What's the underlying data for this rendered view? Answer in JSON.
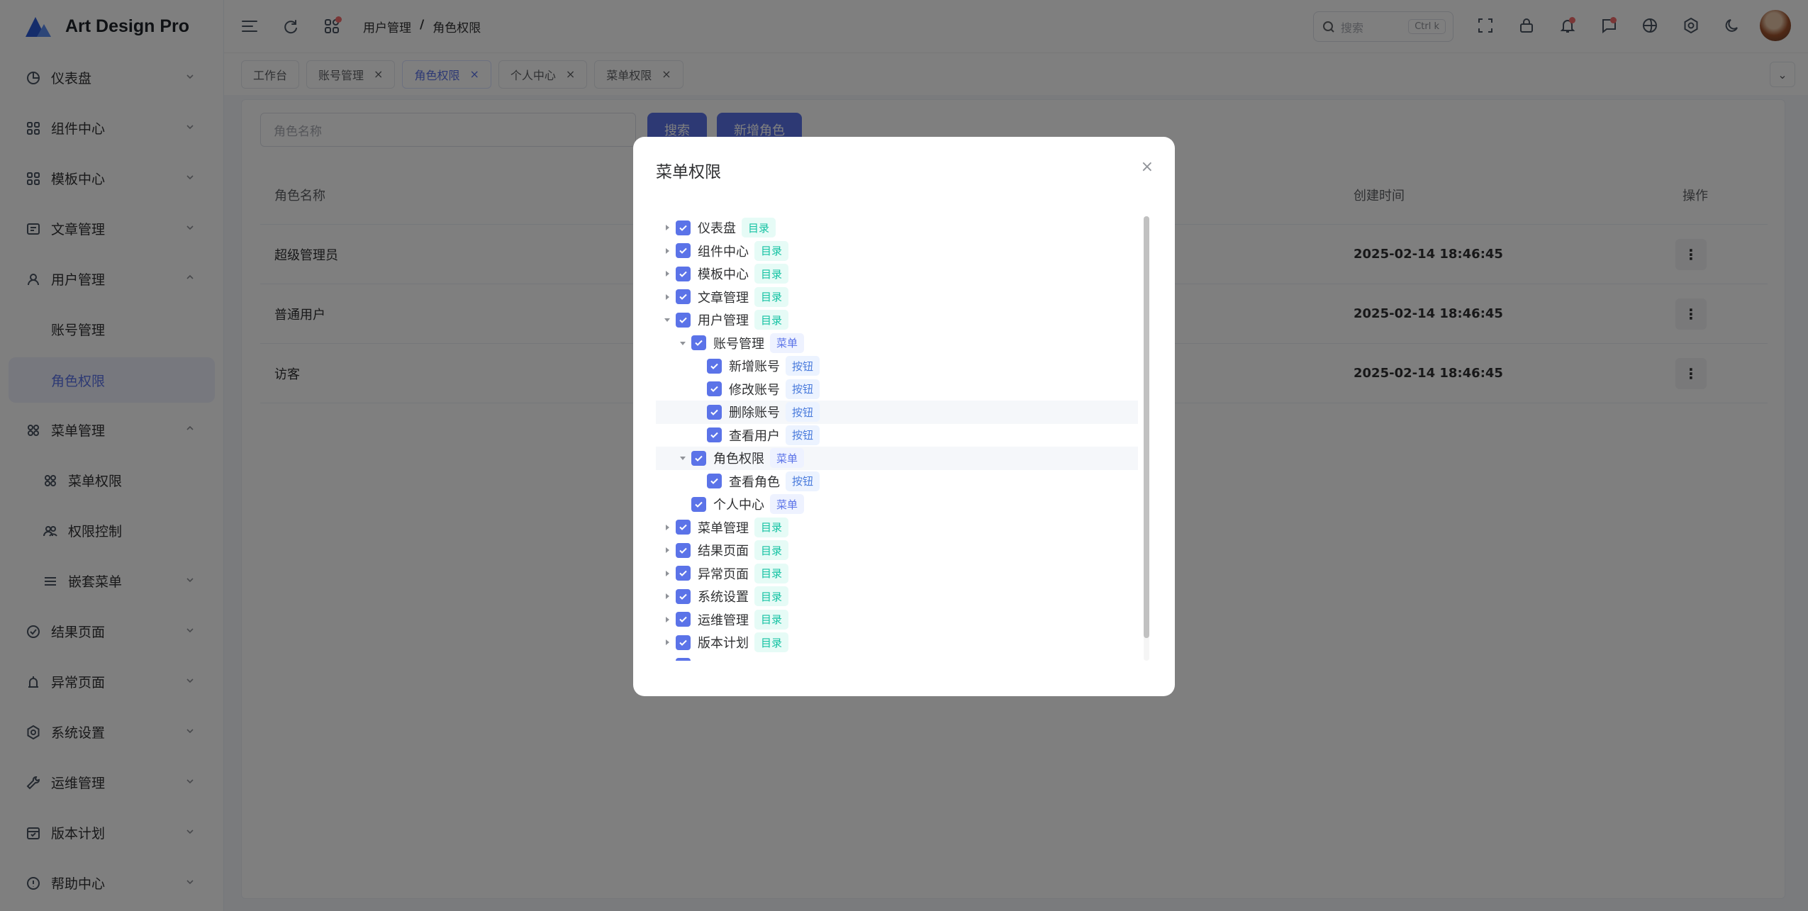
{
  "brand": {
    "name": "Art Design Pro"
  },
  "sidebar": {
    "items": [
      {
        "label": "仪表盘",
        "icon": "dashboard-icon",
        "chevron": "down"
      },
      {
        "label": "组件中心",
        "icon": "components-icon",
        "chevron": "down"
      },
      {
        "label": "模板中心",
        "icon": "template-icon",
        "chevron": "down"
      },
      {
        "label": "文章管理",
        "icon": "article-icon",
        "chevron": "down"
      },
      {
        "label": "用户管理",
        "icon": "users-icon",
        "chevron": "up"
      },
      {
        "label": "账号管理",
        "sub": true
      },
      {
        "label": "角色权限",
        "sub": true,
        "active": true
      },
      {
        "label": "菜单管理",
        "icon": "menu-icon",
        "chevron": "up"
      },
      {
        "label": "菜单权限",
        "sub2": true,
        "icon": "grid-icon"
      },
      {
        "label": "权限控制",
        "sub2": true,
        "icon": "user-group-icon"
      },
      {
        "label": "嵌套菜单",
        "sub2": true,
        "icon": "list-icon",
        "chevron": "down"
      },
      {
        "label": "结果页面",
        "icon": "check-circle-icon",
        "chevron": "down"
      },
      {
        "label": "异常页面",
        "icon": "alarm-icon",
        "chevron": "down"
      },
      {
        "label": "系统设置",
        "icon": "settings-icon",
        "chevron": "down"
      },
      {
        "label": "运维管理",
        "icon": "wrench-icon",
        "chevron": "down"
      },
      {
        "label": "版本计划",
        "icon": "calendar-icon",
        "chevron": "down"
      },
      {
        "label": "帮助中心",
        "icon": "info-icon",
        "chevron": "down"
      }
    ]
  },
  "header": {
    "breadcrumb": [
      "用户管理",
      "角色权限"
    ],
    "breadcrumb_sep": "/",
    "search_placeholder": "搜索",
    "search_shortcut": "Ctrl k"
  },
  "tabs": [
    {
      "label": "工作台",
      "closable": false,
      "active": false
    },
    {
      "label": "账号管理",
      "closable": true,
      "active": false
    },
    {
      "label": "角色权限",
      "closable": true,
      "active": true
    },
    {
      "label": "个人中心",
      "closable": true,
      "active": false
    },
    {
      "label": "菜单权限",
      "closable": true,
      "active": false
    }
  ],
  "main": {
    "search_placeholder": "角色名称",
    "search_button": "搜索",
    "add_button": "新增角色",
    "columns": {
      "name": "角色名称",
      "created": "创建时间",
      "ops": "操作"
    },
    "rows": [
      {
        "name": "超级管理员",
        "created": "2025-02-14 18:46:45",
        "op": "⋮"
      },
      {
        "name": "普通用户",
        "created": "2025-02-14 18:46:45",
        "op": "⋮"
      },
      {
        "name": "访客",
        "created": "2025-02-14 18:46:45",
        "op": "⋮"
      }
    ]
  },
  "dialog": {
    "title": "菜单权限",
    "close": "×",
    "tree": [
      {
        "label": "仪表盘",
        "tag": "目录",
        "type": "dir",
        "level": 0,
        "arrow": "right"
      },
      {
        "label": "组件中心",
        "tag": "目录",
        "type": "dir",
        "level": 0,
        "arrow": "right"
      },
      {
        "label": "模板中心",
        "tag": "目录",
        "type": "dir",
        "level": 0,
        "arrow": "right"
      },
      {
        "label": "文章管理",
        "tag": "目录",
        "type": "dir",
        "level": 0,
        "arrow": "right"
      },
      {
        "label": "用户管理",
        "tag": "目录",
        "type": "dir",
        "level": 0,
        "arrow": "down"
      },
      {
        "label": "账号管理",
        "tag": "菜单",
        "type": "menu",
        "level": 1,
        "arrow": "down"
      },
      {
        "label": "新增账号",
        "tag": "按钮",
        "type": "btnt",
        "level": 2,
        "arrow": ""
      },
      {
        "label": "修改账号",
        "tag": "按钮",
        "type": "btnt",
        "level": 2,
        "arrow": ""
      },
      {
        "label": "删除账号",
        "tag": "按钮",
        "type": "btnt",
        "level": 2,
        "arrow": "",
        "hl": true
      },
      {
        "label": "查看用户",
        "tag": "按钮",
        "type": "btnt",
        "level": 2,
        "arrow": ""
      },
      {
        "label": "角色权限",
        "tag": "菜单",
        "type": "menu",
        "level": 1,
        "arrow": "down",
        "hl": true
      },
      {
        "label": "查看角色",
        "tag": "按钮",
        "type": "btnt",
        "level": 2,
        "arrow": ""
      },
      {
        "label": "个人中心",
        "tag": "菜单",
        "type": "menu",
        "level": 1,
        "arrow": ""
      },
      {
        "label": "菜单管理",
        "tag": "目录",
        "type": "dir",
        "level": 0,
        "arrow": "right"
      },
      {
        "label": "结果页面",
        "tag": "目录",
        "type": "dir",
        "level": 0,
        "arrow": "right"
      },
      {
        "label": "异常页面",
        "tag": "目录",
        "type": "dir",
        "level": 0,
        "arrow": "right"
      },
      {
        "label": "系统设置",
        "tag": "目录",
        "type": "dir",
        "level": 0,
        "arrow": "right"
      },
      {
        "label": "运维管理",
        "tag": "目录",
        "type": "dir",
        "level": 0,
        "arrow": "right"
      },
      {
        "label": "版本计划",
        "tag": "目录",
        "type": "dir",
        "level": 0,
        "arrow": "right"
      }
    ]
  },
  "colors": {
    "primary": "#5b73e8",
    "dir_tag": "#13c2a2",
    "menu_tag": "#5b73e8"
  }
}
